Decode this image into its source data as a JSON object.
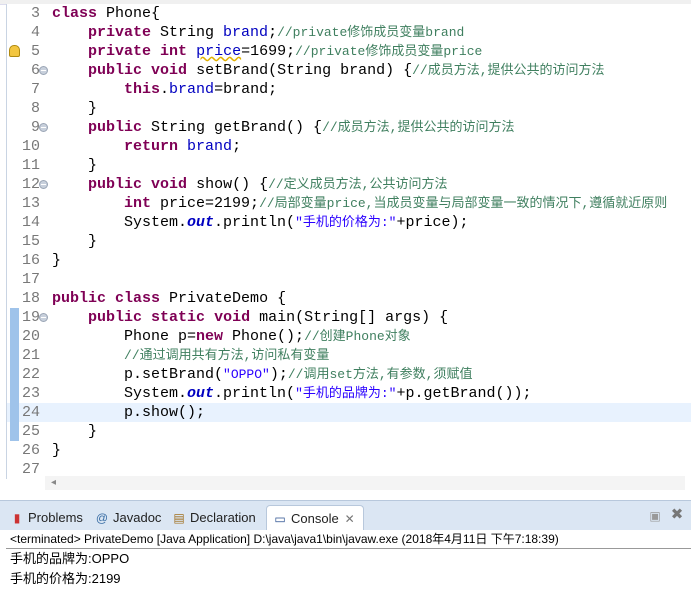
{
  "editor": {
    "first_line": 3,
    "current_line": 24,
    "warning_line": 5,
    "fold_lines": [
      6,
      9,
      12,
      19
    ],
    "diff_lines": [
      19,
      20,
      21,
      22,
      23,
      24,
      25
    ],
    "lines": [
      [
        [
          "kw",
          "class"
        ],
        [
          "tx",
          " Phone{"
        ]
      ],
      [
        [
          "tx",
          "    "
        ],
        [
          "kw",
          "private"
        ],
        [
          "tx",
          " String "
        ],
        [
          "fd",
          "brand"
        ],
        [
          "tx",
          ";"
        ],
        [
          "cm",
          "//private修饰成员变量brand"
        ]
      ],
      [
        [
          "tx",
          "    "
        ],
        [
          "kw",
          "private"
        ],
        [
          "tx",
          " "
        ],
        [
          "kw",
          "int"
        ],
        [
          "tx",
          " "
        ],
        [
          "fdw",
          "price"
        ],
        [
          "tx",
          "=1699;"
        ],
        [
          "cm",
          "//private修饰成员变量price"
        ]
      ],
      [
        [
          "tx",
          "    "
        ],
        [
          "kw",
          "public"
        ],
        [
          "tx",
          " "
        ],
        [
          "kw",
          "void"
        ],
        [
          "tx",
          " setBrand(String brand) {"
        ],
        [
          "cm",
          "//成员方法,提供公共的访问方法"
        ]
      ],
      [
        [
          "tx",
          "        "
        ],
        [
          "kw",
          "this"
        ],
        [
          "tx",
          "."
        ],
        [
          "fd",
          "brand"
        ],
        [
          "tx",
          "=brand;"
        ]
      ],
      [
        [
          "tx",
          "    }"
        ]
      ],
      [
        [
          "tx",
          "    "
        ],
        [
          "kw",
          "public"
        ],
        [
          "tx",
          " String getBrand() {"
        ],
        [
          "cm",
          "//成员方法,提供公共的访问方法"
        ]
      ],
      [
        [
          "tx",
          "        "
        ],
        [
          "kw",
          "return"
        ],
        [
          "tx",
          " "
        ],
        [
          "fd",
          "brand"
        ],
        [
          "tx",
          ";"
        ]
      ],
      [
        [
          "tx",
          "    }"
        ]
      ],
      [
        [
          "tx",
          "    "
        ],
        [
          "kw",
          "public"
        ],
        [
          "tx",
          " "
        ],
        [
          "kw",
          "void"
        ],
        [
          "tx",
          " show() {"
        ],
        [
          "cm",
          "//定义成员方法,公共访问方法"
        ]
      ],
      [
        [
          "tx",
          "        "
        ],
        [
          "kw",
          "int"
        ],
        [
          "tx",
          " price=2199;"
        ],
        [
          "cm",
          "//局部变量price,当成员变量与局部变量一致的情况下,遵循就近原则"
        ]
      ],
      [
        [
          "tx",
          "        System."
        ],
        [
          "sf",
          "out"
        ],
        [
          "tx",
          ".println("
        ],
        [
          "st",
          "\"手机的价格为:\""
        ],
        [
          "tx",
          "+price);"
        ]
      ],
      [
        [
          "tx",
          "    }"
        ]
      ],
      [
        [
          "tx",
          "}"
        ]
      ],
      [
        [
          "tx",
          ""
        ]
      ],
      [
        [
          "kw",
          "public"
        ],
        [
          "tx",
          " "
        ],
        [
          "kw",
          "class"
        ],
        [
          "tx",
          " PrivateDemo {"
        ]
      ],
      [
        [
          "tx",
          "    "
        ],
        [
          "kw",
          "public"
        ],
        [
          "tx",
          " "
        ],
        [
          "kw",
          "static"
        ],
        [
          "tx",
          " "
        ],
        [
          "kw",
          "void"
        ],
        [
          "tx",
          " main(String[] args) {"
        ]
      ],
      [
        [
          "tx",
          "        Phone p="
        ],
        [
          "kw",
          "new"
        ],
        [
          "tx",
          " Phone();"
        ],
        [
          "cm",
          "//创建Phone对象"
        ]
      ],
      [
        [
          "tx",
          "        "
        ],
        [
          "cm",
          "//通过调用共有方法,访问私有变量"
        ]
      ],
      [
        [
          "tx",
          "        p.setBrand("
        ],
        [
          "st",
          "\"OPPO\""
        ],
        [
          "tx",
          ");"
        ],
        [
          "cm",
          "//调用set方法,有参数,须赋值"
        ]
      ],
      [
        [
          "tx",
          "        System."
        ],
        [
          "sf",
          "out"
        ],
        [
          "tx",
          ".println("
        ],
        [
          "st",
          "\"手机的品牌为:\""
        ],
        [
          "tx",
          "+p.getBrand());"
        ]
      ],
      [
        [
          "tx",
          "        p.show();"
        ]
      ],
      [
        [
          "tx",
          "    }"
        ]
      ],
      [
        [
          "tx",
          "}"
        ]
      ],
      [
        [
          "tx",
          ""
        ]
      ]
    ]
  },
  "panel": {
    "tabs": [
      {
        "label": "Problems",
        "icon": "problems-icon",
        "glyph": "▮"
      },
      {
        "label": "Javadoc",
        "icon": "javadoc-icon",
        "glyph": "@"
      },
      {
        "label": "Declaration",
        "icon": "declaration-icon",
        "glyph": "▤"
      },
      {
        "label": "Console",
        "icon": "console-icon",
        "glyph": "▭",
        "active": true
      }
    ],
    "close_glyph": "✕",
    "minimize_glyph": "▣",
    "maximize_glyph": "✖"
  },
  "console": {
    "header": "<terminated> PrivateDemo [Java Application] D:\\java\\java1\\bin\\javaw.exe (2018年4月11日 下午7:18:39)",
    "output": [
      "手机的品牌为:OPPO",
      "手机的价格为:2199"
    ]
  }
}
